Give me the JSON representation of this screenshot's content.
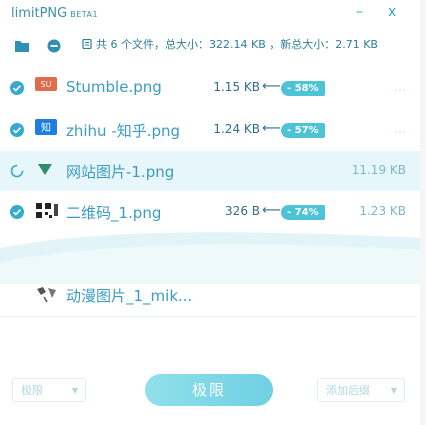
{
  "window": {
    "title": "limitPNG",
    "beta": "BETA1",
    "minimize": "–",
    "close": "x"
  },
  "toolbar": {
    "summary": "共 6 个文件，总大小：322.14 KB ，新总大小：2.71 KB"
  },
  "files": [
    {
      "name": "Stumble.png",
      "orig": "1.15 KB",
      "arrow": "⟵",
      "badge": "- 58%",
      "newsize": "…",
      "status": "done"
    },
    {
      "name": "zhihu -知乎.png",
      "orig": "1.24 KB",
      "arrow": "⟵",
      "badge": "- 57%",
      "newsize": "…",
      "status": "done"
    },
    {
      "name": "网站图片-1.png",
      "orig": "",
      "arrow": "",
      "badge": "",
      "newsize": "11.19 KB",
      "status": "processing"
    },
    {
      "name": "二维码_1.png",
      "orig": "326 B",
      "arrow": "⟵",
      "badge": "- 74%",
      "newsize": "1.23 KB",
      "status": "done"
    },
    {
      "name": "动漫图片_1_mik...",
      "orig": "",
      "arrow": "",
      "badge": "",
      "newsize": "",
      "status": "pending"
    }
  ],
  "bottom": {
    "level_select": "极限",
    "compress_button": "极限",
    "add_suffix_select": "添加后缀"
  },
  "colors": {
    "accent": "#4ec3d6",
    "text": "#3b9cc2",
    "active_row": "#e7f6fa"
  }
}
